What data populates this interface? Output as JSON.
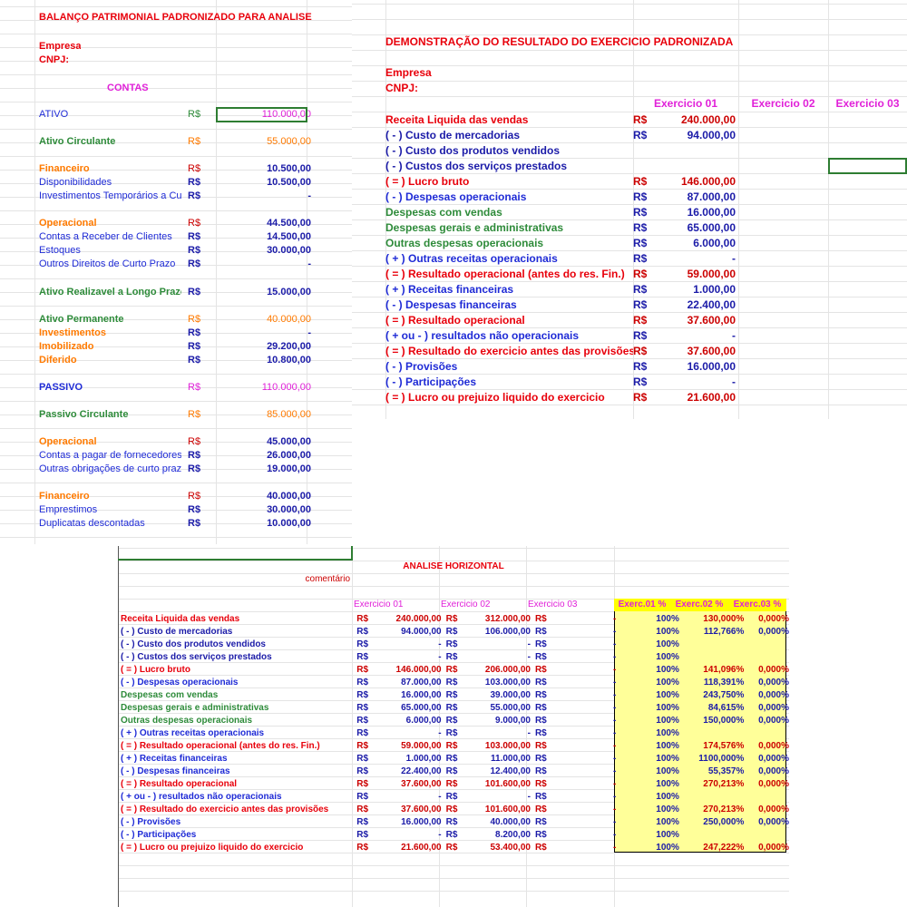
{
  "bp": {
    "title": "BALANÇO PATRIMONIAL PADRONIZADO PARA ANALISE",
    "empresa": "Empresa",
    "cnpj": "CNPJ:",
    "contas": "CONTAS",
    "rs": "R$",
    "rows": [
      {
        "label": "ATIVO",
        "value": "110.000,00"
      },
      {
        "label": "Ativo Circulante",
        "value": "55.000,00"
      },
      {
        "label": "Financeiro",
        "value": "10.500,00"
      },
      {
        "label": "Disponibilidades",
        "value": "10.500,00"
      },
      {
        "label": "Investimentos Temporários a Curto Prazo",
        "value": "-"
      },
      {
        "label": "Operacional",
        "value": "44.500,00"
      },
      {
        "label": "Contas a Receber de Clientes",
        "value": "14.500,00"
      },
      {
        "label": "Estoques",
        "value": "30.000,00"
      },
      {
        "label": "Outros Direitos de Curto Prazo",
        "value": "-"
      },
      {
        "label": "Ativo Realizavel a Longo Prazo",
        "value": "15.000,00"
      },
      {
        "label": "Ativo Permanente",
        "value": "40.000,00"
      },
      {
        "label": "Investimentos",
        "value": "-"
      },
      {
        "label": "Imobilizado",
        "value": "29.200,00"
      },
      {
        "label": "Diferido",
        "value": "10.800,00"
      },
      {
        "label": "PASSIVO",
        "value": "110.000,00"
      },
      {
        "label": "Passivo Circulante",
        "value": "85.000,00"
      },
      {
        "label": "Operacional",
        "value": "45.000,00"
      },
      {
        "label": "Contas a pagar de fornecedores",
        "value": "26.000,00"
      },
      {
        "label": "Outras obrigações de curto prazo",
        "value": "19.000,00"
      },
      {
        "label": "Financeiro",
        "value": "40.000,00"
      },
      {
        "label": "Emprestimos",
        "value": "30.000,00"
      },
      {
        "label": "Duplicatas descontadas",
        "value": "10.000,00"
      }
    ]
  },
  "dre": {
    "title": "DEMONSTRAÇÃO DO RESULTADO DO EXERCICIO PADRONIZADA",
    "empresa": "Empresa",
    "cnpj": "CNPJ:",
    "ex1": "Exercicio 01",
    "ex2": "Exercicio 02",
    "ex3": "Exercicio 03",
    "rs": "R$",
    "rows": [
      {
        "label": "Receita Liquida das vendas",
        "value": "240.000,00"
      },
      {
        "label": "( - ) Custo de mercadorias",
        "value": "94.000,00"
      },
      {
        "label": "( - ) Custo dos produtos vendidos",
        "value": ""
      },
      {
        "label": "( - ) Custos dos serviços prestados",
        "value": ""
      },
      {
        "label": "( = ) Lucro bruto",
        "value": "146.000,00"
      },
      {
        "label": "( - ) Despesas operacionais",
        "value": "87.000,00"
      },
      {
        "label": "Despesas com vendas",
        "value": "16.000,00"
      },
      {
        "label": "Despesas gerais e administrativas",
        "value": "65.000,00"
      },
      {
        "label": "Outras despesas operacionais",
        "value": "6.000,00"
      },
      {
        "label": "( + ) Outras receitas operacionais",
        "value": "-"
      },
      {
        "label": "( = ) Resultado operacional (antes do res. Fin.)",
        "value": "59.000,00"
      },
      {
        "label": "( + ) Receitas financeiras",
        "value": "1.000,00"
      },
      {
        "label": "( - ) Despesas financeiras",
        "value": "22.400,00"
      },
      {
        "label": "( = ) Resultado operacional",
        "value": "37.600,00"
      },
      {
        "label": "( + ou - ) resultados não operacionais",
        "value": "-"
      },
      {
        "label": "( = ) Resultado do exercicio antes das provisões",
        "value": "37.600,00"
      },
      {
        "label": "( - ) Provisões",
        "value": "16.000,00"
      },
      {
        "label": "( - ) Participações",
        "value": "-"
      },
      {
        "label": "( = ) Lucro ou prejuizo liquido do exercicio",
        "value": "21.600,00"
      }
    ]
  },
  "ah": {
    "title": "ANALISE HORIZONTAL",
    "comment": "comentário",
    "ex1": "Exercicio 01",
    "ex2": "Exercicio 02",
    "ex3": "Exercicio 03",
    "p1": "Exerc.01 %",
    "p2": "Exerc.02 %",
    "p3": "Exerc.03 %",
    "rs": "R$",
    "rows": [
      {
        "label": "Receita Liquida das vendas",
        "v1": "240.000,00",
        "v2": "312.000,00",
        "v3": "-",
        "p1": "100%",
        "p2": "130,000%",
        "p3": "0,000%"
      },
      {
        "label": "( - ) Custo de mercadorias",
        "v1": "94.000,00",
        "v2": "106.000,00",
        "v3": "-",
        "p1": "100%",
        "p2": "112,766%",
        "p3": "0,000%"
      },
      {
        "label": "( - ) Custo dos produtos vendidos",
        "v1": "-",
        "v2": "-",
        "v3": "-",
        "p1": "100%",
        "p2": "",
        "p3": ""
      },
      {
        "label": "( - ) Custos dos serviços prestados",
        "v1": "-",
        "v2": "-",
        "v3": "-",
        "p1": "100%",
        "p2": "",
        "p3": ""
      },
      {
        "label": "( = ) Lucro bruto",
        "v1": "146.000,00",
        "v2": "206.000,00",
        "v3": "-",
        "p1": "100%",
        "p2": "141,096%",
        "p3": "0,000%"
      },
      {
        "label": "( - ) Despesas operacionais",
        "v1": "87.000,00",
        "v2": "103.000,00",
        "v3": "-",
        "p1": "100%",
        "p2": "118,391%",
        "p3": "0,000%"
      },
      {
        "label": "Despesas com vendas",
        "v1": "16.000,00",
        "v2": "39.000,00",
        "v3": "-",
        "p1": "100%",
        "p2": "243,750%",
        "p3": "0,000%"
      },
      {
        "label": "Despesas gerais e administrativas",
        "v1": "65.000,00",
        "v2": "55.000,00",
        "v3": "-",
        "p1": "100%",
        "p2": "84,615%",
        "p3": "0,000%"
      },
      {
        "label": "Outras despesas operacionais",
        "v1": "6.000,00",
        "v2": "9.000,00",
        "v3": "-",
        "p1": "100%",
        "p2": "150,000%",
        "p3": "0,000%"
      },
      {
        "label": "( + ) Outras receitas operacionais",
        "v1": "-",
        "v2": "-",
        "v3": "-",
        "p1": "100%",
        "p2": "",
        "p3": ""
      },
      {
        "label": "( = ) Resultado operacional (antes do res. Fin.)",
        "v1": "59.000,00",
        "v2": "103.000,00",
        "v3": "-",
        "p1": "100%",
        "p2": "174,576%",
        "p3": "0,000%"
      },
      {
        "label": "( + ) Receitas financeiras",
        "v1": "1.000,00",
        "v2": "11.000,00",
        "v3": "-",
        "p1": "100%",
        "p2": "1100,000%",
        "p3": "0,000%"
      },
      {
        "label": "( - ) Despesas financeiras",
        "v1": "22.400,00",
        "v2": "12.400,00",
        "v3": "-",
        "p1": "100%",
        "p2": "55,357%",
        "p3": "0,000%"
      },
      {
        "label": "( = ) Resultado operacional",
        "v1": "37.600,00",
        "v2": "101.600,00",
        "v3": "-",
        "p1": "100%",
        "p2": "270,213%",
        "p3": "0,000%"
      },
      {
        "label": "( + ou - ) resultados não operacionais",
        "v1": "-",
        "v2": "-",
        "v3": "-",
        "p1": "100%",
        "p2": "",
        "p3": ""
      },
      {
        "label": "( = ) Resultado do exercicio antes das provisões",
        "v1": "37.600,00",
        "v2": "101.600,00",
        "v3": "-",
        "p1": "100%",
        "p2": "270,213%",
        "p3": "0,000%"
      },
      {
        "label": "( - ) Provisões",
        "v1": "16.000,00",
        "v2": "40.000,00",
        "v3": "-",
        "p1": "100%",
        "p2": "250,000%",
        "p3": "0,000%"
      },
      {
        "label": "( - ) Participações",
        "v1": "-",
        "v2": "8.200,00",
        "v3": "-",
        "p1": "100%",
        "p2": "",
        "p3": ""
      },
      {
        "label": "( = ) Lucro ou prejuizo liquido do exercicio",
        "v1": "21.600,00",
        "v2": "53.400,00",
        "v3": "-",
        "p1": "100%",
        "p2": "247,222%",
        "p3": "0,000%"
      }
    ]
  }
}
